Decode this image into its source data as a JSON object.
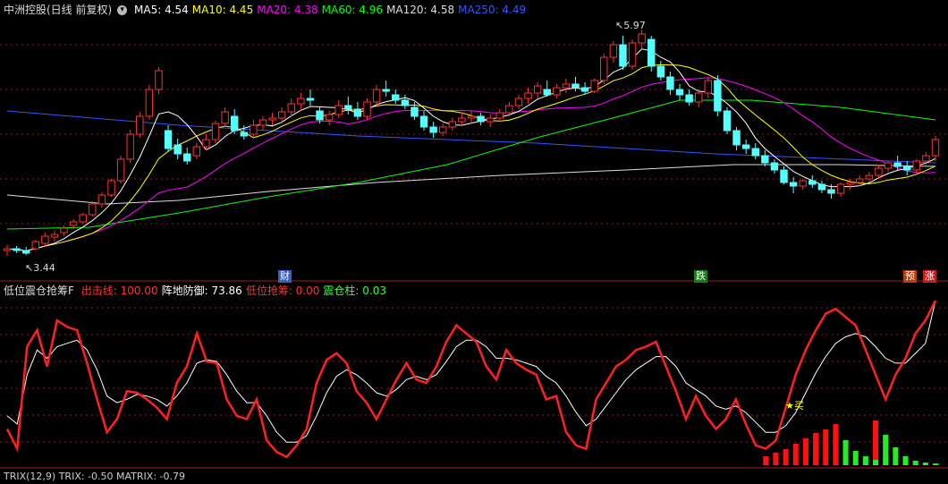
{
  "main_panel": {
    "title": "中洲控股(日线 前复权)",
    "ma_legend": [
      {
        "label": "MA5:",
        "value": "4.54",
        "color": "#ffffff"
      },
      {
        "label": "MA10:",
        "value": "4.45",
        "color": "#ffff00"
      },
      {
        "label": "MA20:",
        "value": "4.38",
        "color": "#ff00ff"
      },
      {
        "label": "MA60:",
        "value": "4.96",
        "color": "#00ff00"
      },
      {
        "label": "MA120:",
        "value": "4.58",
        "color": "#dddddd"
      },
      {
        "label": "MA250:",
        "value": "4.49",
        "color": "#3355ff"
      }
    ],
    "high_marker": "5.97",
    "low_marker": "3.44",
    "tags": {
      "cai": "财",
      "die": "跌",
      "yu": "预",
      "zhang": "涨"
    }
  },
  "indicator_panel": {
    "title": "低位震仓抢筹F",
    "items": [
      {
        "label": "出击线:",
        "value": "100.00",
        "color": "#ff3030"
      },
      {
        "label": "阵地防御:",
        "value": "73.86",
        "color": "#ffffff"
      },
      {
        "label": "低位抢筹:",
        "value": "0.00",
        "color": "#ff3030"
      },
      {
        "label": "震仓柱:",
        "value": "0.03",
        "color": "#33ff33"
      }
    ],
    "buy_signal": "★买"
  },
  "triple_panel": {
    "text": "TRIX(12,9)  TRIX: -0.50  MATRIX: -0.79"
  },
  "colors": {
    "up": "#ff3232",
    "down": "#54ffff",
    "grid": "#8a1a1a",
    "separator": "#a01a1a"
  },
  "chart_data": {
    "type": "candlestick",
    "ylim": [
      3.3,
      6.1
    ],
    "candles": [
      [
        3.5,
        3.56,
        3.44,
        3.52
      ],
      [
        3.52,
        3.55,
        3.47,
        3.5
      ],
      [
        3.5,
        3.54,
        3.45,
        3.47
      ],
      [
        3.52,
        3.62,
        3.5,
        3.6
      ],
      [
        3.58,
        3.7,
        3.55,
        3.66
      ],
      [
        3.65,
        3.72,
        3.6,
        3.68
      ],
      [
        3.7,
        3.78,
        3.66,
        3.75
      ],
      [
        3.78,
        3.85,
        3.74,
        3.82
      ],
      [
        3.82,
        3.92,
        3.8,
        3.9
      ],
      [
        3.9,
        4.05,
        3.88,
        4.02
      ],
      [
        4.02,
        4.15,
        3.98,
        4.12
      ],
      [
        4.12,
        4.3,
        4.1,
        4.28
      ],
      [
        4.28,
        4.56,
        4.25,
        4.52
      ],
      [
        4.52,
        4.85,
        4.48,
        4.8
      ],
      [
        4.8,
        5.05,
        4.76,
        5.0
      ],
      [
        5.0,
        5.35,
        4.96,
        5.3
      ],
      [
        5.3,
        5.55,
        5.25,
        5.51
      ],
      [
        4.84,
        4.9,
        4.6,
        4.64
      ],
      [
        4.68,
        4.75,
        4.52,
        4.58
      ],
      [
        4.58,
        4.65,
        4.46,
        4.5
      ],
      [
        4.56,
        4.7,
        4.52,
        4.66
      ],
      [
        4.66,
        4.8,
        4.62,
        4.74
      ],
      [
        4.74,
        4.95,
        4.7,
        4.92
      ],
      [
        4.92,
        5.1,
        4.88,
        5.05
      ],
      [
        5.0,
        5.08,
        4.8,
        4.84
      ],
      [
        4.82,
        4.9,
        4.74,
        4.78
      ],
      [
        4.8,
        4.96,
        4.76,
        4.9
      ],
      [
        4.9,
        5.0,
        4.84,
        4.96
      ],
      [
        4.96,
        5.04,
        4.9,
        4.98
      ],
      [
        4.98,
        5.1,
        4.92,
        5.05
      ],
      [
        5.05,
        5.2,
        5.0,
        5.14
      ],
      [
        5.14,
        5.26,
        5.06,
        5.2
      ],
      [
        5.2,
        5.3,
        5.12,
        5.18
      ],
      [
        5.06,
        5.1,
        4.92,
        4.96
      ],
      [
        4.96,
        5.06,
        4.9,
        5.02
      ],
      [
        5.02,
        5.18,
        4.98,
        5.12
      ],
      [
        5.12,
        5.22,
        5.02,
        5.08
      ],
      [
        5.08,
        5.16,
        4.96,
        5.0
      ],
      [
        5.0,
        5.2,
        4.96,
        5.16
      ],
      [
        5.16,
        5.35,
        5.12,
        5.3
      ],
      [
        5.3,
        5.4,
        5.22,
        5.28
      ],
      [
        5.24,
        5.3,
        5.14,
        5.18
      ],
      [
        5.18,
        5.24,
        5.08,
        5.12
      ],
      [
        5.1,
        5.16,
        4.96,
        5.0
      ],
      [
        5.0,
        5.06,
        4.84,
        4.88
      ],
      [
        4.88,
        4.94,
        4.76,
        4.82
      ],
      [
        4.82,
        4.92,
        4.78,
        4.88
      ],
      [
        4.88,
        4.98,
        4.84,
        4.94
      ],
      [
        4.94,
        5.04,
        4.9,
        4.98
      ],
      [
        4.98,
        5.06,
        4.92,
        5.0
      ],
      [
        5.0,
        5.04,
        4.9,
        4.94
      ],
      [
        4.94,
        5.02,
        4.88,
        4.98
      ],
      [
        4.98,
        5.08,
        4.94,
        5.04
      ],
      [
        5.04,
        5.16,
        5.0,
        5.12
      ],
      [
        5.12,
        5.24,
        5.08,
        5.2
      ],
      [
        5.2,
        5.32,
        5.14,
        5.26
      ],
      [
        5.26,
        5.38,
        5.2,
        5.34
      ],
      [
        5.3,
        5.4,
        5.22,
        5.24
      ],
      [
        5.24,
        5.36,
        5.2,
        5.32
      ],
      [
        5.32,
        5.42,
        5.26,
        5.36
      ],
      [
        5.36,
        5.44,
        5.28,
        5.32
      ],
      [
        5.32,
        5.38,
        5.24,
        5.28
      ],
      [
        5.28,
        5.42,
        5.26,
        5.4
      ],
      [
        5.4,
        5.7,
        5.36,
        5.66
      ],
      [
        5.66,
        5.84,
        5.6,
        5.8
      ],
      [
        5.8,
        5.9,
        5.52,
        5.56
      ],
      [
        5.56,
        5.86,
        5.52,
        5.82
      ],
      [
        5.82,
        5.97,
        5.76,
        5.92
      ],
      [
        5.86,
        5.9,
        5.5,
        5.56
      ],
      [
        5.56,
        5.62,
        5.4,
        5.44
      ],
      [
        5.44,
        5.5,
        5.24,
        5.3
      ],
      [
        5.3,
        5.36,
        5.18,
        5.24
      ],
      [
        5.24,
        5.3,
        5.12,
        5.16
      ],
      [
        5.16,
        5.3,
        5.1,
        5.26
      ],
      [
        5.26,
        5.44,
        5.2,
        5.4
      ],
      [
        5.4,
        5.46,
        5.0,
        5.06
      ],
      [
        5.06,
        5.1,
        4.8,
        4.84
      ],
      [
        4.84,
        4.88,
        4.62,
        4.68
      ],
      [
        4.68,
        4.74,
        4.58,
        4.64
      ],
      [
        4.64,
        4.7,
        4.52,
        4.56
      ],
      [
        4.56,
        4.62,
        4.44,
        4.48
      ],
      [
        4.48,
        4.52,
        4.36,
        4.4
      ],
      [
        4.4,
        4.44,
        4.24,
        4.26
      ],
      [
        4.26,
        4.32,
        4.14,
        4.22
      ],
      [
        4.22,
        4.3,
        4.18,
        4.28
      ],
      [
        4.28,
        4.34,
        4.2,
        4.24
      ],
      [
        4.24,
        4.28,
        4.14,
        4.18
      ],
      [
        4.18,
        4.24,
        4.08,
        4.14
      ],
      [
        4.14,
        4.26,
        4.1,
        4.24
      ],
      [
        4.24,
        4.3,
        4.18,
        4.26
      ],
      [
        4.26,
        4.34,
        4.22,
        4.3
      ],
      [
        4.3,
        4.38,
        4.26,
        4.34
      ],
      [
        4.34,
        4.46,
        4.3,
        4.42
      ],
      [
        4.42,
        4.5,
        4.38,
        4.48
      ],
      [
        4.48,
        4.56,
        4.4,
        4.44
      ],
      [
        4.44,
        4.5,
        4.34,
        4.4
      ],
      [
        4.4,
        4.52,
        4.36,
        4.5
      ],
      [
        4.5,
        4.6,
        4.46,
        4.56
      ],
      [
        4.56,
        4.78,
        4.5,
        4.74
      ]
    ],
    "indicator_red": [
      22,
      10,
      72,
      82,
      60,
      88,
      84,
      82,
      62,
      40,
      20,
      28,
      45,
      44,
      40,
      35,
      28,
      50,
      60,
      80,
      63,
      62,
      40,
      30,
      28,
      40,
      15,
      8,
      5,
      12,
      22,
      50,
      64,
      68,
      62,
      45,
      38,
      28,
      40,
      52,
      62,
      52,
      50,
      60,
      75,
      85,
      80,
      75,
      60,
      52,
      70,
      62,
      58,
      55,
      40,
      42,
      20,
      12,
      10,
      40,
      50,
      60,
      64,
      70,
      72,
      75,
      60,
      45,
      28,
      42,
      30,
      22,
      28,
      40,
      25,
      12,
      10,
      15,
      35,
      55,
      70,
      82,
      92,
      95,
      90,
      85,
      70,
      55,
      40,
      55,
      65,
      80,
      88,
      100
    ],
    "indicator_white": [
      30,
      25,
      55,
      70,
      65,
      72,
      74,
      76,
      70,
      58,
      42,
      38,
      40,
      43,
      42,
      40,
      36,
      42,
      50,
      62,
      64,
      63,
      55,
      45,
      38,
      38,
      30,
      20,
      14,
      14,
      18,
      30,
      44,
      54,
      58,
      55,
      50,
      44,
      42,
      46,
      52,
      54,
      52,
      55,
      63,
      72,
      76,
      76,
      72,
      65,
      65,
      64,
      62,
      60,
      54,
      50,
      42,
      32,
      24,
      28,
      36,
      44,
      52,
      58,
      62,
      66,
      66,
      60,
      50,
      46,
      42,
      36,
      34,
      36,
      32,
      26,
      20,
      20,
      24,
      32,
      44,
      56,
      66,
      74,
      78,
      80,
      78,
      72,
      65,
      62,
      62,
      68,
      74,
      100
    ],
    "bars_red": [
      {
        "i": 76,
        "h": 10
      },
      {
        "i": 77,
        "h": 14
      },
      {
        "i": 78,
        "h": 18
      },
      {
        "i": 79,
        "h": 24
      },
      {
        "i": 80,
        "h": 30
      },
      {
        "i": 81,
        "h": 36
      },
      {
        "i": 82,
        "h": 40
      },
      {
        "i": 83,
        "h": 46
      }
    ],
    "bars_green": [
      {
        "i": 84,
        "h": 28
      },
      {
        "i": 85,
        "h": 16
      },
      {
        "i": 86,
        "h": 10
      },
      {
        "i": 87,
        "h": 6
      },
      {
        "i": 88,
        "h": 34
      },
      {
        "i": 89,
        "h": 20
      },
      {
        "i": 90,
        "h": 10
      },
      {
        "i": 91,
        "h": 5
      },
      {
        "i": 92,
        "h": 3
      },
      {
        "i": 93,
        "h": 2
      }
    ],
    "bars_red_late": [
      {
        "i": 87,
        "h": 50
      }
    ]
  }
}
